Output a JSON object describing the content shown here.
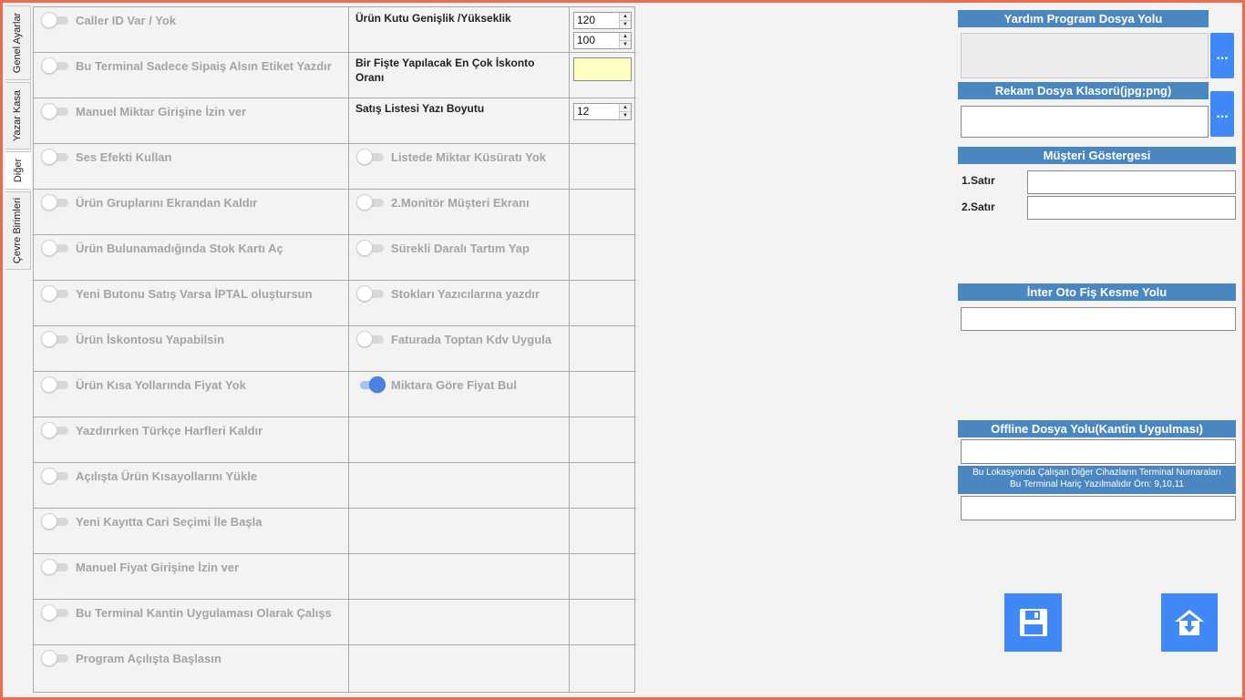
{
  "tabs": [
    {
      "label": "Genel Ayarlar",
      "active": false
    },
    {
      "label": "Yazar Kasa",
      "active": false
    },
    {
      "label": "Diğer",
      "active": true
    },
    {
      "label": "Çevre Birimleri",
      "active": false
    }
  ],
  "left_toggles": [
    {
      "label": "Caller ID Var / Yok",
      "on": false
    },
    {
      "label": "Bu Terminal Sadece Sipaiş Alsın Etiket Yazdır",
      "on": false
    },
    {
      "label": "Manuel Miktar Girişine İzin ver",
      "on": false
    },
    {
      "label": "Ses Efekti Kullan",
      "on": false
    },
    {
      "label": "Ürün Gruplarını Ekrandan Kaldır",
      "on": false
    },
    {
      "label": "Ürün Bulunamadığında Stok Kartı Aç",
      "on": false
    },
    {
      "label": "Yeni Butonu  Satış Varsa İPTAL oluştursun",
      "on": false
    },
    {
      "label": "Ürün İskontosu Yapabilsin",
      "on": false
    },
    {
      "label": "Ürün  Kısa Yollarında Fiyat Yok",
      "on": false
    },
    {
      "label": "Yazdırırken Türkçe Harfleri Kaldır",
      "on": false
    },
    {
      "label": "Açılışta Ürün Kısayollarını Yükle",
      "on": false
    },
    {
      "label": "Yeni Kayıtta Cari Seçimi İle Başla",
      "on": false
    },
    {
      "label": "Manuel Fiyat Girişine İzin ver",
      "on": false
    },
    {
      "label": "Bu Terminal Kantin Uygulaması Olarak Çalışs",
      "on": false
    },
    {
      "label": "Program Açılışta Başlasın",
      "on": false
    }
  ],
  "right_toggles": [
    {
      "label": "Listede Miktar Küsüratı Yok",
      "on": false
    },
    {
      "label": "2.Monitör Müşteri Ekranı",
      "on": false
    },
    {
      "label": "Sürekli Daralı Tartım Yap",
      "on": false
    },
    {
      "label": "Stokları Yazıcılarına yazdır",
      "on": false
    },
    {
      "label": "Faturada Toptan Kdv Uygula",
      "on": false
    },
    {
      "label": "Miktara Göre Fiyat Bul",
      "on": true
    }
  ],
  "fields": {
    "box_size_label": "Ürün Kutu Genişlik /Yükseklik",
    "box_width": "120",
    "box_height": "100",
    "max_discount_label": "Bir Fişte Yapılacak En Çok İskonto Oranı",
    "max_discount_value": "",
    "font_size_label": "Satış Listesi Yazı Boyutu",
    "font_size_value": "12"
  },
  "right_panel": {
    "help_path_title": "Yardım Program Dosya Yolu",
    "help_path_value": "",
    "ad_folder_title": "Rekam Dosya Klasorü(jpg;png)",
    "ad_folder_value": "",
    "browse_label": "...",
    "customer_display_title": "Müşteri Göstergesi",
    "line1_label": "1.Satır",
    "line1_value": "",
    "line2_label": "2.Satır",
    "line2_value": "",
    "auto_receipt_title": "İnter Oto Fiş Kesme Yolu",
    "auto_receipt_value": "",
    "offline_title": "Offline Dosya Yolu(Kantin Uygulması)",
    "offline_value": "",
    "terminal_note_line1": "Bu Lokasyonda Çalışan Diğer Cihazların Terminal Numaraları",
    "terminal_note_line2": "Bu Terminal Hariç Yazılmalıdır Örn: 9,10,11",
    "terminal_numbers_value": ""
  },
  "icons": {
    "save": "floppy-disk-icon",
    "export": "home-download-icon",
    "up": "▲",
    "down": "▼"
  },
  "colors": {
    "accent": "#4a86c0",
    "button": "#3f88f5",
    "frame": "#ee6c4d",
    "toggle_on": "#4b82e8",
    "highlight_input": "#ffffc4"
  }
}
